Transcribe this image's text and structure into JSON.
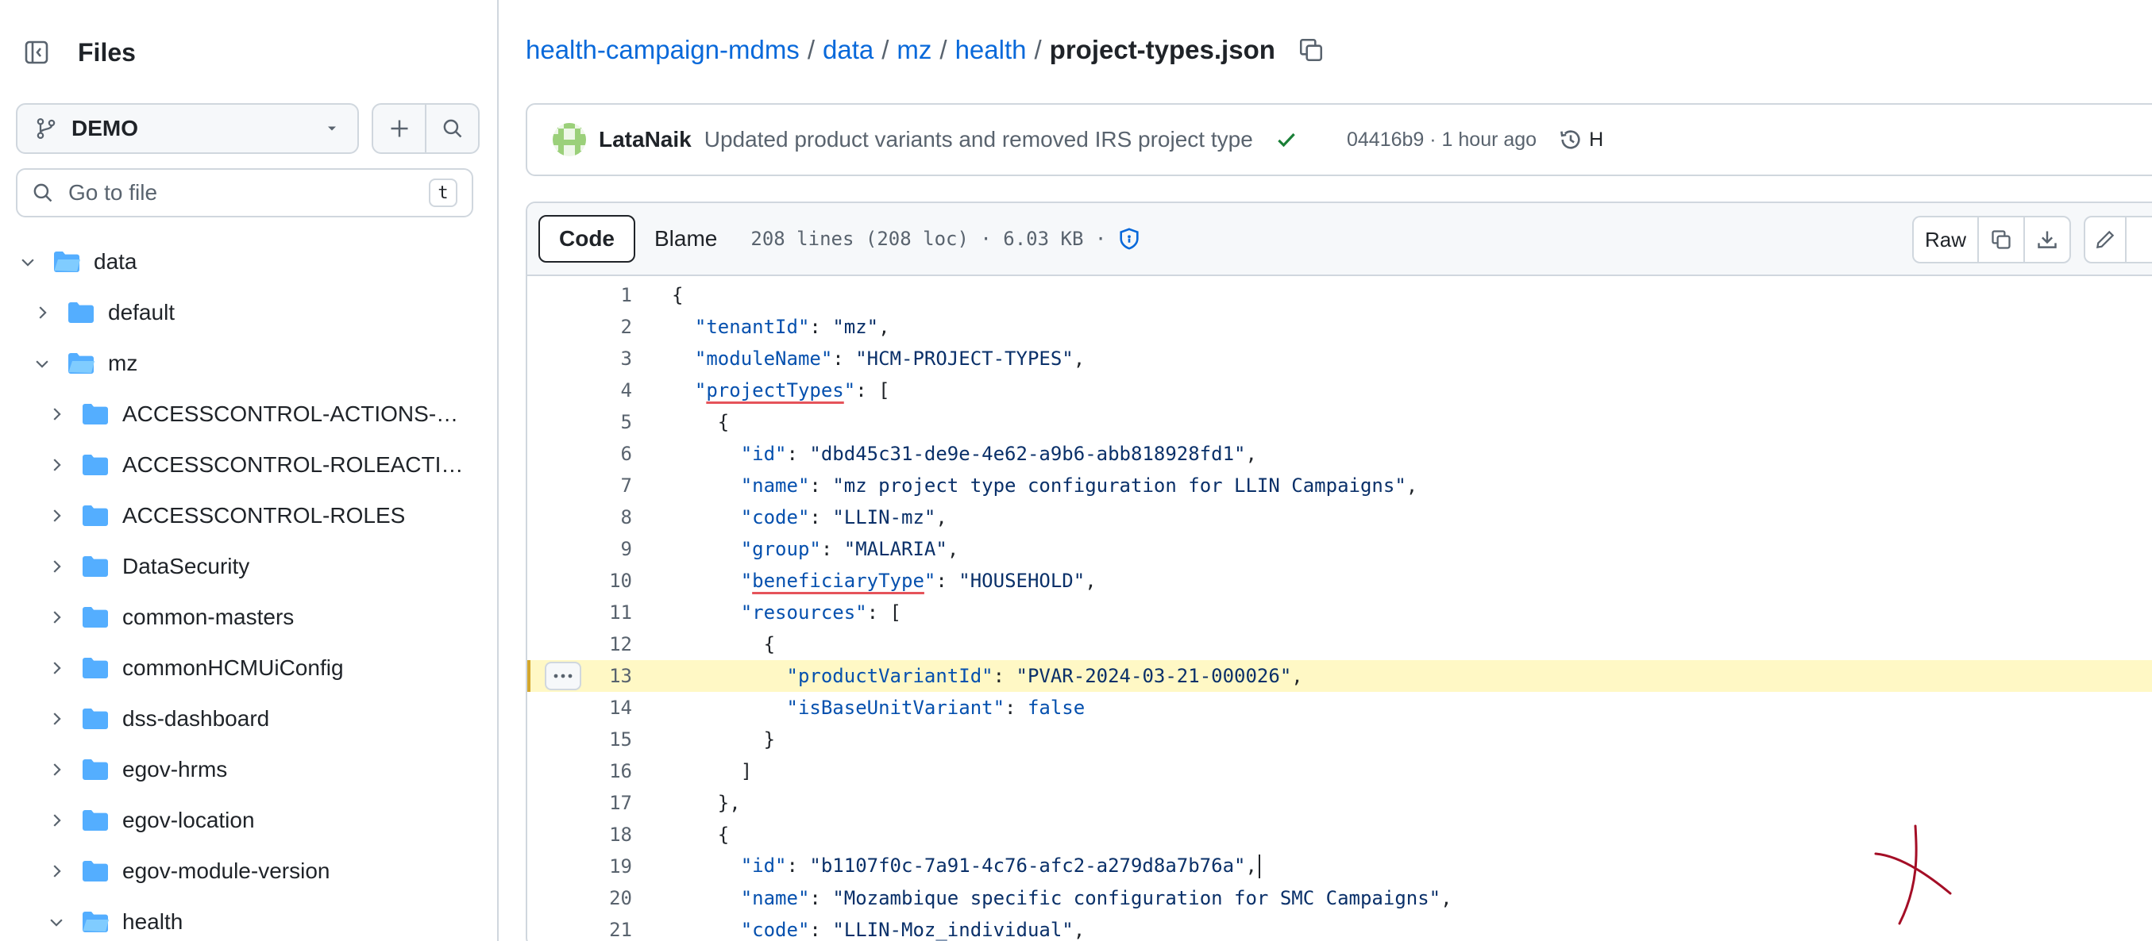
{
  "sidebar": {
    "title": "Files",
    "branch": "DEMO",
    "goto_placeholder": "Go to file",
    "goto_shortcut": "t",
    "tree": [
      {
        "label": "data",
        "depth": 0,
        "expanded": true
      },
      {
        "label": "default",
        "depth": 1,
        "expanded": false
      },
      {
        "label": "mz",
        "depth": 1,
        "expanded": true
      },
      {
        "label": "ACCESSCONTROL-ACTIONS-T...",
        "depth": 2,
        "expanded": false
      },
      {
        "label": "ACCESSCONTROL-ROLEACTIO...",
        "depth": 2,
        "expanded": false
      },
      {
        "label": "ACCESSCONTROL-ROLES",
        "depth": 2,
        "expanded": false
      },
      {
        "label": "DataSecurity",
        "depth": 2,
        "expanded": false
      },
      {
        "label": "common-masters",
        "depth": 2,
        "expanded": false
      },
      {
        "label": "commonHCMUiConfig",
        "depth": 2,
        "expanded": false
      },
      {
        "label": "dss-dashboard",
        "depth": 2,
        "expanded": false
      },
      {
        "label": "egov-hrms",
        "depth": 2,
        "expanded": false
      },
      {
        "label": "egov-location",
        "depth": 2,
        "expanded": false
      },
      {
        "label": "egov-module-version",
        "depth": 2,
        "expanded": false
      },
      {
        "label": "health",
        "depth": 2,
        "expanded": true
      }
    ]
  },
  "breadcrumb": {
    "repo": "health-campaign-mdms",
    "parts": [
      "data",
      "mz",
      "health"
    ],
    "separator": "/",
    "file": "project-types.json"
  },
  "commit": {
    "author": "LataNaik",
    "message": "Updated product variants and removed IRS project type",
    "hash": "04416b9",
    "time": "1 hour ago",
    "history_label": "H"
  },
  "file_header": {
    "tabs": [
      "Code",
      "Blame"
    ],
    "active_tab": "Code",
    "info": "208 lines (208 loc) · 6.03 KB ·",
    "raw_label": "Raw"
  },
  "code_lines": [
    {
      "n": "1",
      "text": "{"
    },
    {
      "n": "2",
      "text": "  \"tenantId\": \"mz\","
    },
    {
      "n": "3",
      "text": "  \"moduleName\": \"HCM-PROJECT-TYPES\","
    },
    {
      "n": "4",
      "text": "  \"projectTypes\": ["
    },
    {
      "n": "5",
      "text": "    {"
    },
    {
      "n": "6",
      "text": "      \"id\": \"dbd45c31-de9e-4e62-a9b6-abb818928fd1\","
    },
    {
      "n": "7",
      "text": "      \"name\": \"mz project type configuration for LLIN Campaigns\","
    },
    {
      "n": "8",
      "text": "      \"code\": \"LLIN-mz\","
    },
    {
      "n": "9",
      "text": "      \"group\": \"MALARIA\","
    },
    {
      "n": "10",
      "text": "      \"beneficiaryType\": \"HOUSEHOLD\","
    },
    {
      "n": "11",
      "text": "      \"resources\": ["
    },
    {
      "n": "12",
      "text": "        {"
    },
    {
      "n": "13",
      "text": "          \"productVariantId\": \"PVAR-2024-03-21-000026\","
    },
    {
      "n": "14",
      "text": "          \"isBaseUnitVariant\": false"
    },
    {
      "n": "15",
      "text": "        }"
    },
    {
      "n": "16",
      "text": "      ]"
    },
    {
      "n": "17",
      "text": "    },"
    },
    {
      "n": "18",
      "text": "    {"
    },
    {
      "n": "19",
      "text": "      \"id\": \"b1107f0c-7a91-4c76-afc2-a279d8a7b76a\","
    },
    {
      "n": "20",
      "text": "      \"name\": \"Mozambique specific configuration for SMC Campaigns\","
    },
    {
      "n": "21",
      "text": "      \"code\": \"LLIN-Moz_individual\","
    }
  ],
  "highlighted_line": "13",
  "colors": {
    "link": "#0969da",
    "key": "#0550ae",
    "string": "#0a3069",
    "highlight_bg": "#fff8c5",
    "folder": "#54aeff",
    "check": "#1a7f37",
    "annotation": "#a40e26"
  },
  "icons": [
    "sidebar-collapse-icon",
    "git-branch-icon",
    "caret-down-icon",
    "plus-icon",
    "search-icon",
    "chevron-right-icon",
    "chevron-down-icon",
    "folder-icon",
    "copy-icon",
    "check-icon",
    "history-icon",
    "shield-icon",
    "download-icon",
    "pencil-icon",
    "kebab-icon"
  ]
}
